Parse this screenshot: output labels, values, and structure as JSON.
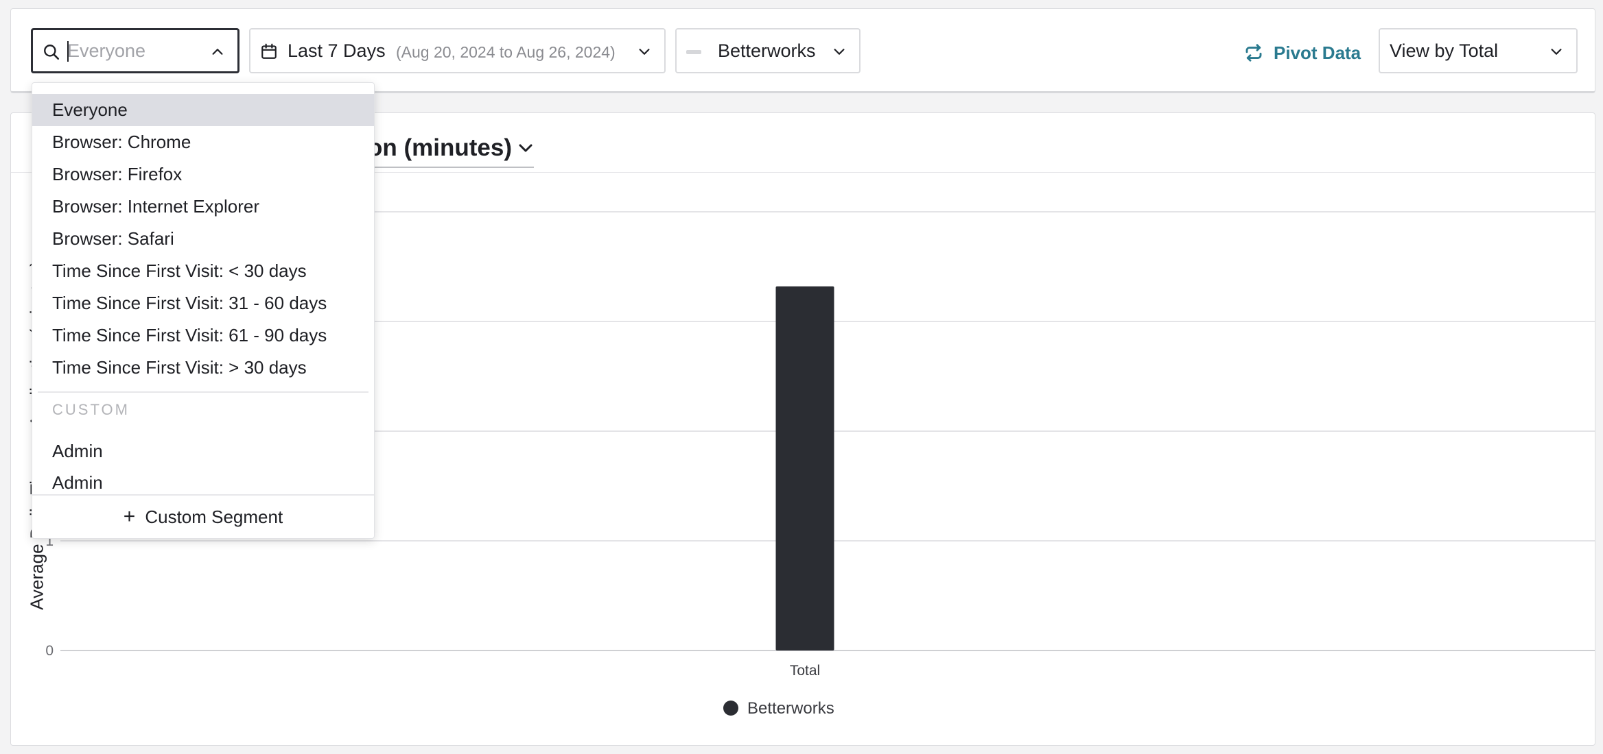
{
  "toolbar": {
    "segment_search": {
      "placeholder": "Everyone",
      "value": ""
    },
    "date_range": {
      "label": "Last 7 Days",
      "range": "(Aug 20, 2024 to Aug 26, 2024)"
    },
    "app": {
      "name": "Betterworks"
    },
    "pivot_label": "Pivot Data",
    "view_by": "View by Total"
  },
  "dropdown": {
    "items": [
      "Everyone",
      "Browser: Chrome",
      "Browser: Firefox",
      "Browser: Internet Explorer",
      "Browser: Safari",
      "Time Since First Visit: < 30 days",
      "Time Since First Visit: 31 - 60 days",
      "Time Since First Visit: 61 - 90 days",
      "Time Since First Visit: > 30 days"
    ],
    "selected_index": 0,
    "custom_group_label": "CUSTOM",
    "custom_items": [
      "Admin",
      "Admin"
    ],
    "footer_label": "Custom Segment"
  },
  "metric_selector": {
    "visible_text": "on (minutes)"
  },
  "colors": {
    "accent": "#2a7a8f",
    "bar": "#2b2d33",
    "selected_bg": "#dcdde3"
  },
  "icons": [
    "search-icon",
    "chevron-up-icon",
    "calendar-icon",
    "chevron-down-icon",
    "pivot-icon",
    "plus-icon"
  ],
  "chart_data": {
    "type": "bar",
    "categories": [
      "Total"
    ],
    "series": [
      {
        "name": "Betterworks",
        "values": [
          3.32
        ],
        "color": "#2b2d33"
      }
    ],
    "ylabel": "Average Daily Time on Application (minutes)",
    "visible_yticks": [
      "0",
      "1"
    ],
    "ylim": [
      0,
      4
    ],
    "grid": true,
    "legend": "bottom-center"
  }
}
